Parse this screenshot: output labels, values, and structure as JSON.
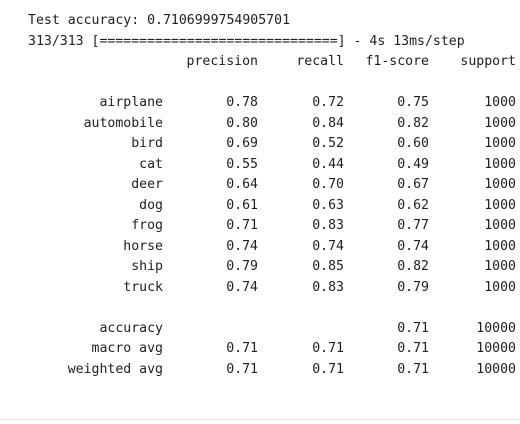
{
  "output": {
    "accuracy_line": "Test accuracy: 0.7106999754905701",
    "progress_line": "313/313 [==============================] - 4s 13ms/step",
    "headers": {
      "precision": "precision",
      "recall": "recall",
      "f1": "f1-score",
      "support": "support"
    },
    "rows": [
      {
        "label": "airplane",
        "precision": "0.78",
        "recall": "0.72",
        "f1": "0.75",
        "support": "1000"
      },
      {
        "label": "automobile",
        "precision": "0.80",
        "recall": "0.84",
        "f1": "0.82",
        "support": "1000"
      },
      {
        "label": "bird",
        "precision": "0.69",
        "recall": "0.52",
        "f1": "0.60",
        "support": "1000"
      },
      {
        "label": "cat",
        "precision": "0.55",
        "recall": "0.44",
        "f1": "0.49",
        "support": "1000"
      },
      {
        "label": "deer",
        "precision": "0.64",
        "recall": "0.70",
        "f1": "0.67",
        "support": "1000"
      },
      {
        "label": "dog",
        "precision": "0.61",
        "recall": "0.63",
        "f1": "0.62",
        "support": "1000"
      },
      {
        "label": "frog",
        "precision": "0.71",
        "recall": "0.83",
        "f1": "0.77",
        "support": "1000"
      },
      {
        "label": "horse",
        "precision": "0.74",
        "recall": "0.74",
        "f1": "0.74",
        "support": "1000"
      },
      {
        "label": "ship",
        "precision": "0.79",
        "recall": "0.85",
        "f1": "0.82",
        "support": "1000"
      },
      {
        "label": "truck",
        "precision": "0.74",
        "recall": "0.83",
        "f1": "0.79",
        "support": "1000"
      }
    ],
    "summary": {
      "accuracy": {
        "label": "accuracy",
        "f1": "0.71",
        "support": "10000"
      },
      "macro": {
        "label": "macro avg",
        "precision": "0.71",
        "recall": "0.71",
        "f1": "0.71",
        "support": "10000"
      },
      "weighted": {
        "label": "weighted avg",
        "precision": "0.71",
        "recall": "0.71",
        "f1": "0.71",
        "support": "10000"
      }
    }
  }
}
